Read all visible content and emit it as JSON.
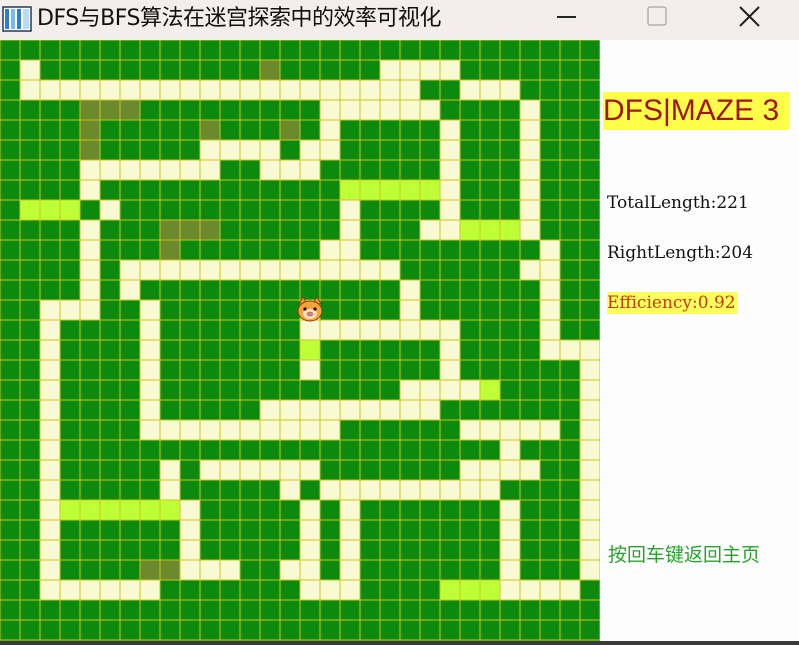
{
  "window": {
    "title": "DFS与BFS算法在迷宫探索中的效率可视化",
    "app_icon": "maze-app-icon",
    "controls": [
      "minimize-icon",
      "maximize-icon",
      "close-icon"
    ]
  },
  "panel": {
    "mode_title": "DFS|MAZE 3",
    "total_length": "TotalLength:221",
    "right_length": "RightLength:204",
    "efficiency": "Efficiency:0.92",
    "hint": "按回车键返回主页"
  },
  "maze": {
    "cols": 30,
    "rows": 30,
    "legend": {
      "#": "wall",
      "p": "path",
      "g": "visited-dead-end",
      "d": "dark-marker"
    },
    "agent_icon": "pig-cat-agent-icon",
    "colors": {
      "wall": "#0d8a0d",
      "path": "#fafad2",
      "visited": "#bfff35",
      "dark": "#6c8a2c",
      "grid": "#c8c81e",
      "title_bg": "#ffff4a",
      "title_fg": "#a1140f",
      "efficiency_bg": "#ffff5e",
      "efficiency_fg": "#c43a0a",
      "hint": "#26a32a"
    },
    "grid": [
      "##############################",
      "#p###########d#####pppp#######",
      "#pppppppppppppppppppp##ppp####",
      "####ddd#########pppppp####p###",
      "####d#####d###d#p#####p###p###",
      "####d#####pppp#pp#####p###p###",
      "####ppppppp##ppp######p###p###",
      "####p############gggggp###p###",
      "#ggg#p###########p####p###p###",
      "####p###ddd######p###ppgggp###",
      "####p###d#######pp#########p###",
      "####p#pppppppppppppp######pp##",
      "####p#p#############p######p##",
      "##ppp##p#######x####p######p##",
      "##p####p#######pppppppp####p##",
      "##p####p#######g######p####ppp",
      "##p####p#######p######p######p",
      "##p####p############ppppg####p",
      "##p####p#####ppppppppp#######p",
      "##p####pppppppppp######ppppp#p",
      "##p######################p###p",
      "##p#####p#pppppp#######pppp##p",
      "##p#####p#####p#ppppppppp####p",
      "##pggggggp#####p#p#######p###p",
      "##p######p#####p#p#######p###p",
      "##p######p#####p#p#######p###p",
      "##p####ddppp##pp#p#######p###p",
      "##pppppp#######ppp####gggpppp#",
      "##############################",
      "##############################"
    ]
  }
}
